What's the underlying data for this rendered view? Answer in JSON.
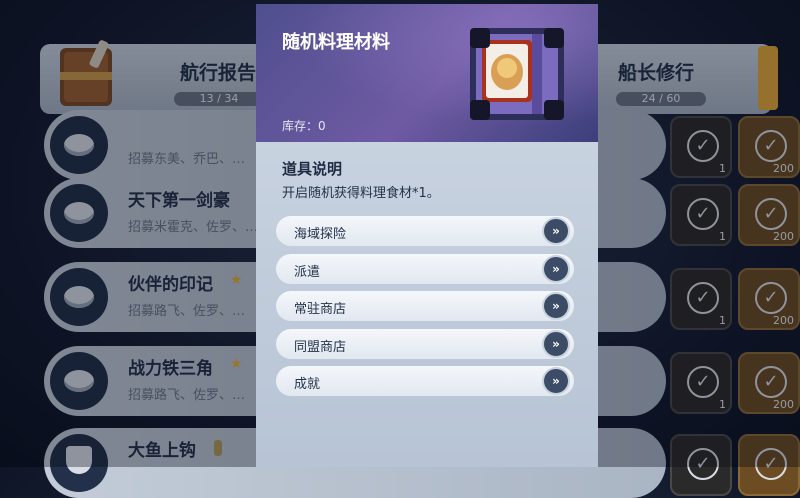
{
  "tabs": {
    "left": {
      "label": "航行报告",
      "progress": "13 / 34"
    },
    "right": {
      "label": "船长修行",
      "progress": "24 / 60"
    }
  },
  "rows": [
    {
      "title": "",
      "desc": "招募东美、乔巴、…",
      "reward_count_dark": "1",
      "reward_count_gold": "200"
    },
    {
      "title": "天下第一剑豪",
      "desc": "招募米霍克、佐罗、…",
      "reward_count_dark": "1",
      "reward_count_gold": "200"
    },
    {
      "title": "伙伴的印记",
      "desc": "招募路飞、佐罗、…",
      "reward_count_dark": "1",
      "reward_count_gold": "200"
    },
    {
      "title": "战力铁三角",
      "desc": "招募路飞、佐罗、…",
      "reward_count_dark": "1",
      "reward_count_gold": "200"
    },
    {
      "title": "大鱼上钩",
      "desc": "",
      "badge": "",
      "reward_count_dark": "",
      "reward_count_gold": ""
    }
  ],
  "modal": {
    "title": "随机料理材料",
    "stock": "库存：0",
    "section_title": "道具说明",
    "section_desc": "开启随机获得料理食材*1。",
    "sources": [
      {
        "label": "海域探险"
      },
      {
        "label": "派遣"
      },
      {
        "label": "常驻商店"
      },
      {
        "label": "同盟商店"
      },
      {
        "label": "成就"
      }
    ],
    "arrow_glyph": "»"
  },
  "colors": {
    "header": "#5a4f95",
    "panel": "#c3cedb",
    "arrow_button": "#3c4b66"
  }
}
